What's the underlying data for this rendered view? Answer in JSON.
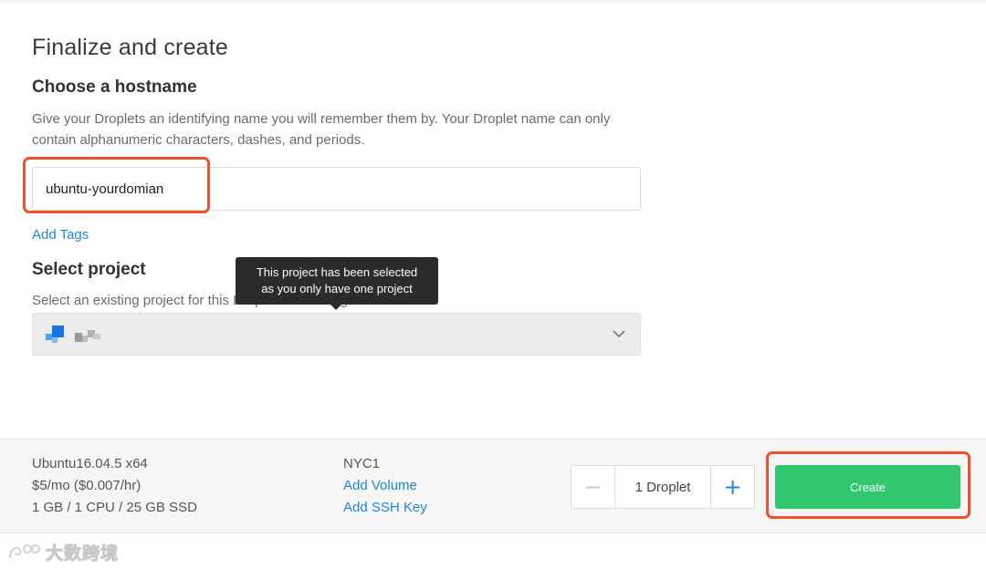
{
  "finalize": {
    "title": "Finalize and create"
  },
  "hostname": {
    "heading": "Choose a hostname",
    "description": "Give your Droplets an identifying name you will remember them by. Your Droplet name can only contain alphanumeric characters, dashes, and periods.",
    "value": "ubuntu-yourdomian",
    "add_tags_label": "Add Tags"
  },
  "project": {
    "heading": "Select project",
    "description": "Select an existing project for this Droplet/s to belong to.",
    "tooltip_line1": "This project has been selected",
    "tooltip_line2": "as you only have one project",
    "selected_icon": "project-logo-icon"
  },
  "summary": {
    "image": "Ubuntu16.04.5 x64",
    "price": "$5/mo ($0.007/hr)",
    "size": "1 GB / 1 CPU / 25 GB SSD",
    "region": "NYC1",
    "add_volume_label": "Add Volume",
    "add_ssh_key_label": "Add SSH Key"
  },
  "quantity": {
    "minus": "−",
    "plus": "+",
    "count_label": "1  Droplet"
  },
  "actions": {
    "create_label": "Create"
  },
  "watermark": {
    "text": "大数跨境"
  },
  "colors": {
    "accent_blue": "#1e88d8",
    "create_green": "#31c76f",
    "highlight_red": "#f0502a"
  }
}
